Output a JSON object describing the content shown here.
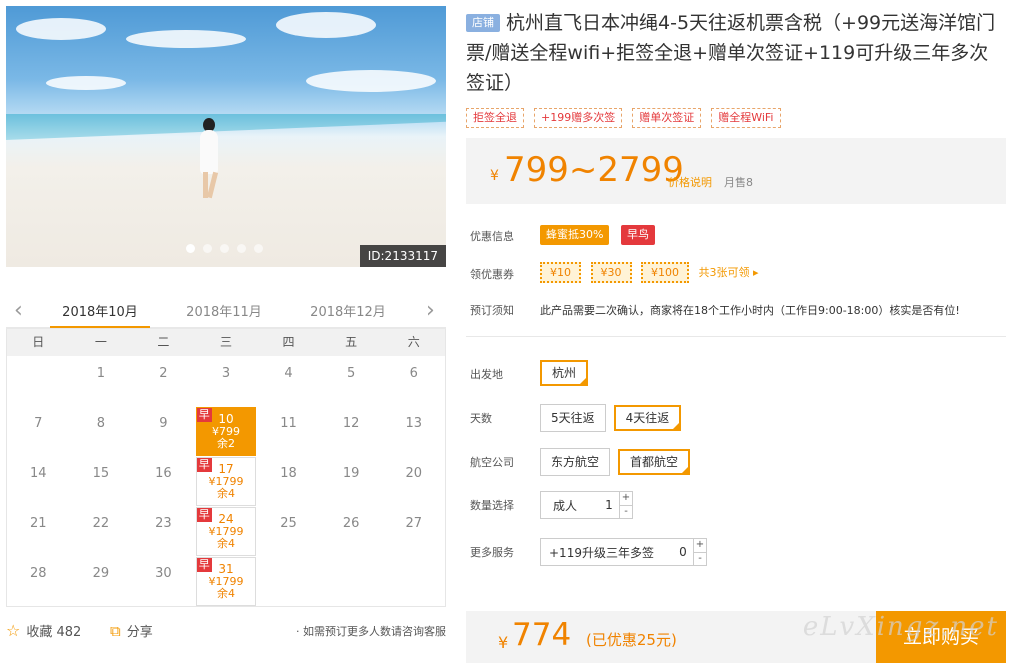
{
  "image": {
    "id_label": "ID:2133117",
    "dots": 5,
    "active_dot": 0
  },
  "calendar": {
    "months": [
      "2018年10月",
      "2018年11月",
      "2018年12月"
    ],
    "active_month": 0,
    "weekdays": [
      "日",
      "一",
      "二",
      "三",
      "四",
      "五",
      "六"
    ],
    "days": [
      {
        "d": ""
      },
      {
        "d": "1"
      },
      {
        "d": "2"
      },
      {
        "d": "3"
      },
      {
        "d": "4"
      },
      {
        "d": "5"
      },
      {
        "d": "6"
      },
      {
        "d": "7"
      },
      {
        "d": "8"
      },
      {
        "d": "9"
      },
      {
        "d": "10",
        "badge": "早",
        "price": "¥799",
        "left": "余2",
        "active": true
      },
      {
        "d": "11"
      },
      {
        "d": "12"
      },
      {
        "d": "13"
      },
      {
        "d": "14"
      },
      {
        "d": "15"
      },
      {
        "d": "16"
      },
      {
        "d": "17",
        "badge": "早",
        "price": "¥1799",
        "left": "余4"
      },
      {
        "d": "18"
      },
      {
        "d": "19"
      },
      {
        "d": "20"
      },
      {
        "d": "21"
      },
      {
        "d": "22"
      },
      {
        "d": "23"
      },
      {
        "d": "24",
        "badge": "早",
        "price": "¥1799",
        "left": "余4"
      },
      {
        "d": "25"
      },
      {
        "d": "26"
      },
      {
        "d": "27"
      },
      {
        "d": "28"
      },
      {
        "d": "29"
      },
      {
        "d": "30"
      },
      {
        "d": "31",
        "badge": "早",
        "price": "¥1799",
        "left": "余4"
      },
      {
        "d": ""
      },
      {
        "d": ""
      },
      {
        "d": ""
      }
    ]
  },
  "footer": {
    "fav_label": "收藏",
    "fav_count": "482",
    "share_label": "分享",
    "hint": "· 如需预订更多人数请咨询客服"
  },
  "product": {
    "shop_tag": "店铺",
    "title": "杭州直飞日本冲绳4-5天往返机票含税（+99元送海洋馆门票/赠送全程wifi+拒签全退+赠单次签证+119可升级三年多次签证）",
    "tags": [
      "拒签全退",
      "+199赠多次签",
      "赠单次签证",
      "赠全程WiFi"
    ],
    "price_symbol": "¥",
    "price_range": "799~2799",
    "price_note": "价格说明",
    "monthly_sales": "月售8"
  },
  "promo": {
    "label": "优惠信息",
    "tags": [
      {
        "text": "蜂蜜抵30%",
        "color": "#f39800"
      },
      {
        "text": "早鸟",
        "color": "#e4393c"
      }
    ]
  },
  "coupons": {
    "label": "领优惠券",
    "items": [
      "¥10",
      "¥30",
      "¥100"
    ],
    "more": "共3张可领 ▸"
  },
  "notice": {
    "label": "预订须知",
    "text": "此产品需要二次确认，商家将在18个工作小时内（工作日9:00-18:00）核实是否有位!"
  },
  "options": {
    "departure": {
      "label": "出发地",
      "values": [
        "杭州"
      ],
      "selected": 0
    },
    "days": {
      "label": "天数",
      "values": [
        "5天往返",
        "4天往返"
      ],
      "selected": 1
    },
    "airline": {
      "label": "航空公司",
      "values": [
        "东方航空",
        "首都航空"
      ],
      "selected": 1
    },
    "quantity": {
      "label": "数量选择",
      "name": "成人",
      "value": "1"
    },
    "service": {
      "label": "更多服务",
      "name": "+119升级三年多签",
      "value": "0"
    }
  },
  "bottom": {
    "price_symbol": "¥",
    "price": "774",
    "saved": "(已优惠25元)",
    "buy_label": "立即购买"
  },
  "watermark": "eLvXingz.net"
}
